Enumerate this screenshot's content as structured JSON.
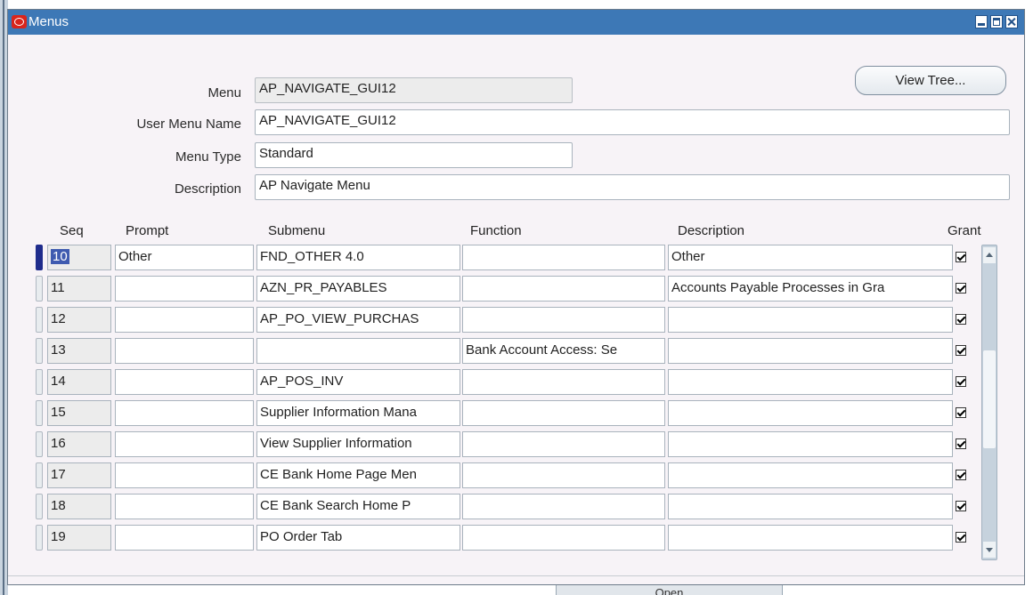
{
  "window": {
    "title": "Menus"
  },
  "header": {
    "menu_label": "Menu",
    "menu_value": "AP_NAVIGATE_GUI12",
    "user_menu_name_label": "User Menu Name",
    "user_menu_name_value": "AP_NAVIGATE_GUI12",
    "menu_type_label": "Menu Type",
    "menu_type_value": "Standard",
    "description_label": "Description",
    "description_value": "AP Navigate Menu",
    "view_tree_label": "View Tree..."
  },
  "table": {
    "columns": {
      "seq": "Seq",
      "prompt": "Prompt",
      "submenu": "Submenu",
      "function": "Function",
      "description": "Description",
      "grant": "Grant"
    },
    "rows": [
      {
        "seq": "10",
        "prompt": "Other",
        "submenu": "FND_OTHER 4.0",
        "function": "",
        "description": "Other",
        "grant": true
      },
      {
        "seq": "11",
        "prompt": "",
        "submenu": "AZN_PR_PAYABLES",
        "function": "",
        "description": "Accounts Payable Processes in Gra",
        "grant": true
      },
      {
        "seq": "12",
        "prompt": "",
        "submenu": "AP_PO_VIEW_PURCHAS",
        "function": "",
        "description": "",
        "grant": true
      },
      {
        "seq": "13",
        "prompt": "",
        "submenu": "",
        "function": "Bank Account Access: Se",
        "description": "",
        "grant": true
      },
      {
        "seq": "14",
        "prompt": "",
        "submenu": "AP_POS_INV",
        "function": "",
        "description": "",
        "grant": true
      },
      {
        "seq": "15",
        "prompt": "",
        "submenu": "Supplier Information Mana",
        "function": "",
        "description": "",
        "grant": true
      },
      {
        "seq": "16",
        "prompt": "",
        "submenu": "View Supplier Information",
        "function": "",
        "description": "",
        "grant": true
      },
      {
        "seq": "17",
        "prompt": "",
        "submenu": "CE Bank Home Page Men",
        "function": "",
        "description": "",
        "grant": true
      },
      {
        "seq": "18",
        "prompt": "",
        "submenu": "CE Bank Search Home P",
        "function": "",
        "description": "",
        "grant": true
      },
      {
        "seq": "19",
        "prompt": "",
        "submenu": "PO Order Tab",
        "function": "",
        "description": "",
        "grant": true
      }
    ]
  },
  "background": {
    "button_label": "Open"
  },
  "colors": {
    "titlebar": "#3d78b6",
    "selection": "#3f5bb0",
    "row_indicator_current": "#1f2c8c"
  }
}
